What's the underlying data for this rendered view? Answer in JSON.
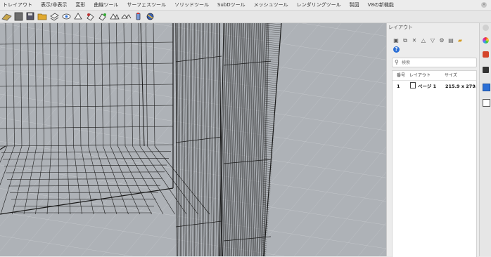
{
  "menubar": {
    "tabs": [
      "トレイアウト",
      "表示/非表示",
      "変形",
      "曲線ツール",
      "サーフェスツール",
      "ソリッドツール",
      "SubDツール",
      "メッシュツール",
      "レンダリングツール",
      "製図",
      "V8の新機能"
    ]
  },
  "toolbar": {
    "icons": [
      "cplane-icon",
      "grid-icon",
      "save-icon",
      "open-folder-icon",
      "layer-icon",
      "hide-icon",
      "show-icon",
      "lock-icon",
      "unlock-icon",
      "properties-icon",
      "match-icon",
      "paint-icon",
      "sun-icon"
    ]
  },
  "panel": {
    "title": "レイアウト",
    "search_placeholder": "検索",
    "columns": {
      "number": "番号",
      "layout": "レイアウト",
      "size": "サイズ"
    },
    "rows": [
      {
        "number": "1",
        "name": "ページ 1",
        "size": "215.9 x 279."
      }
    ]
  },
  "colors": {
    "viewport_bg": "#aeb2b7",
    "accent": "#2b6fd6"
  }
}
